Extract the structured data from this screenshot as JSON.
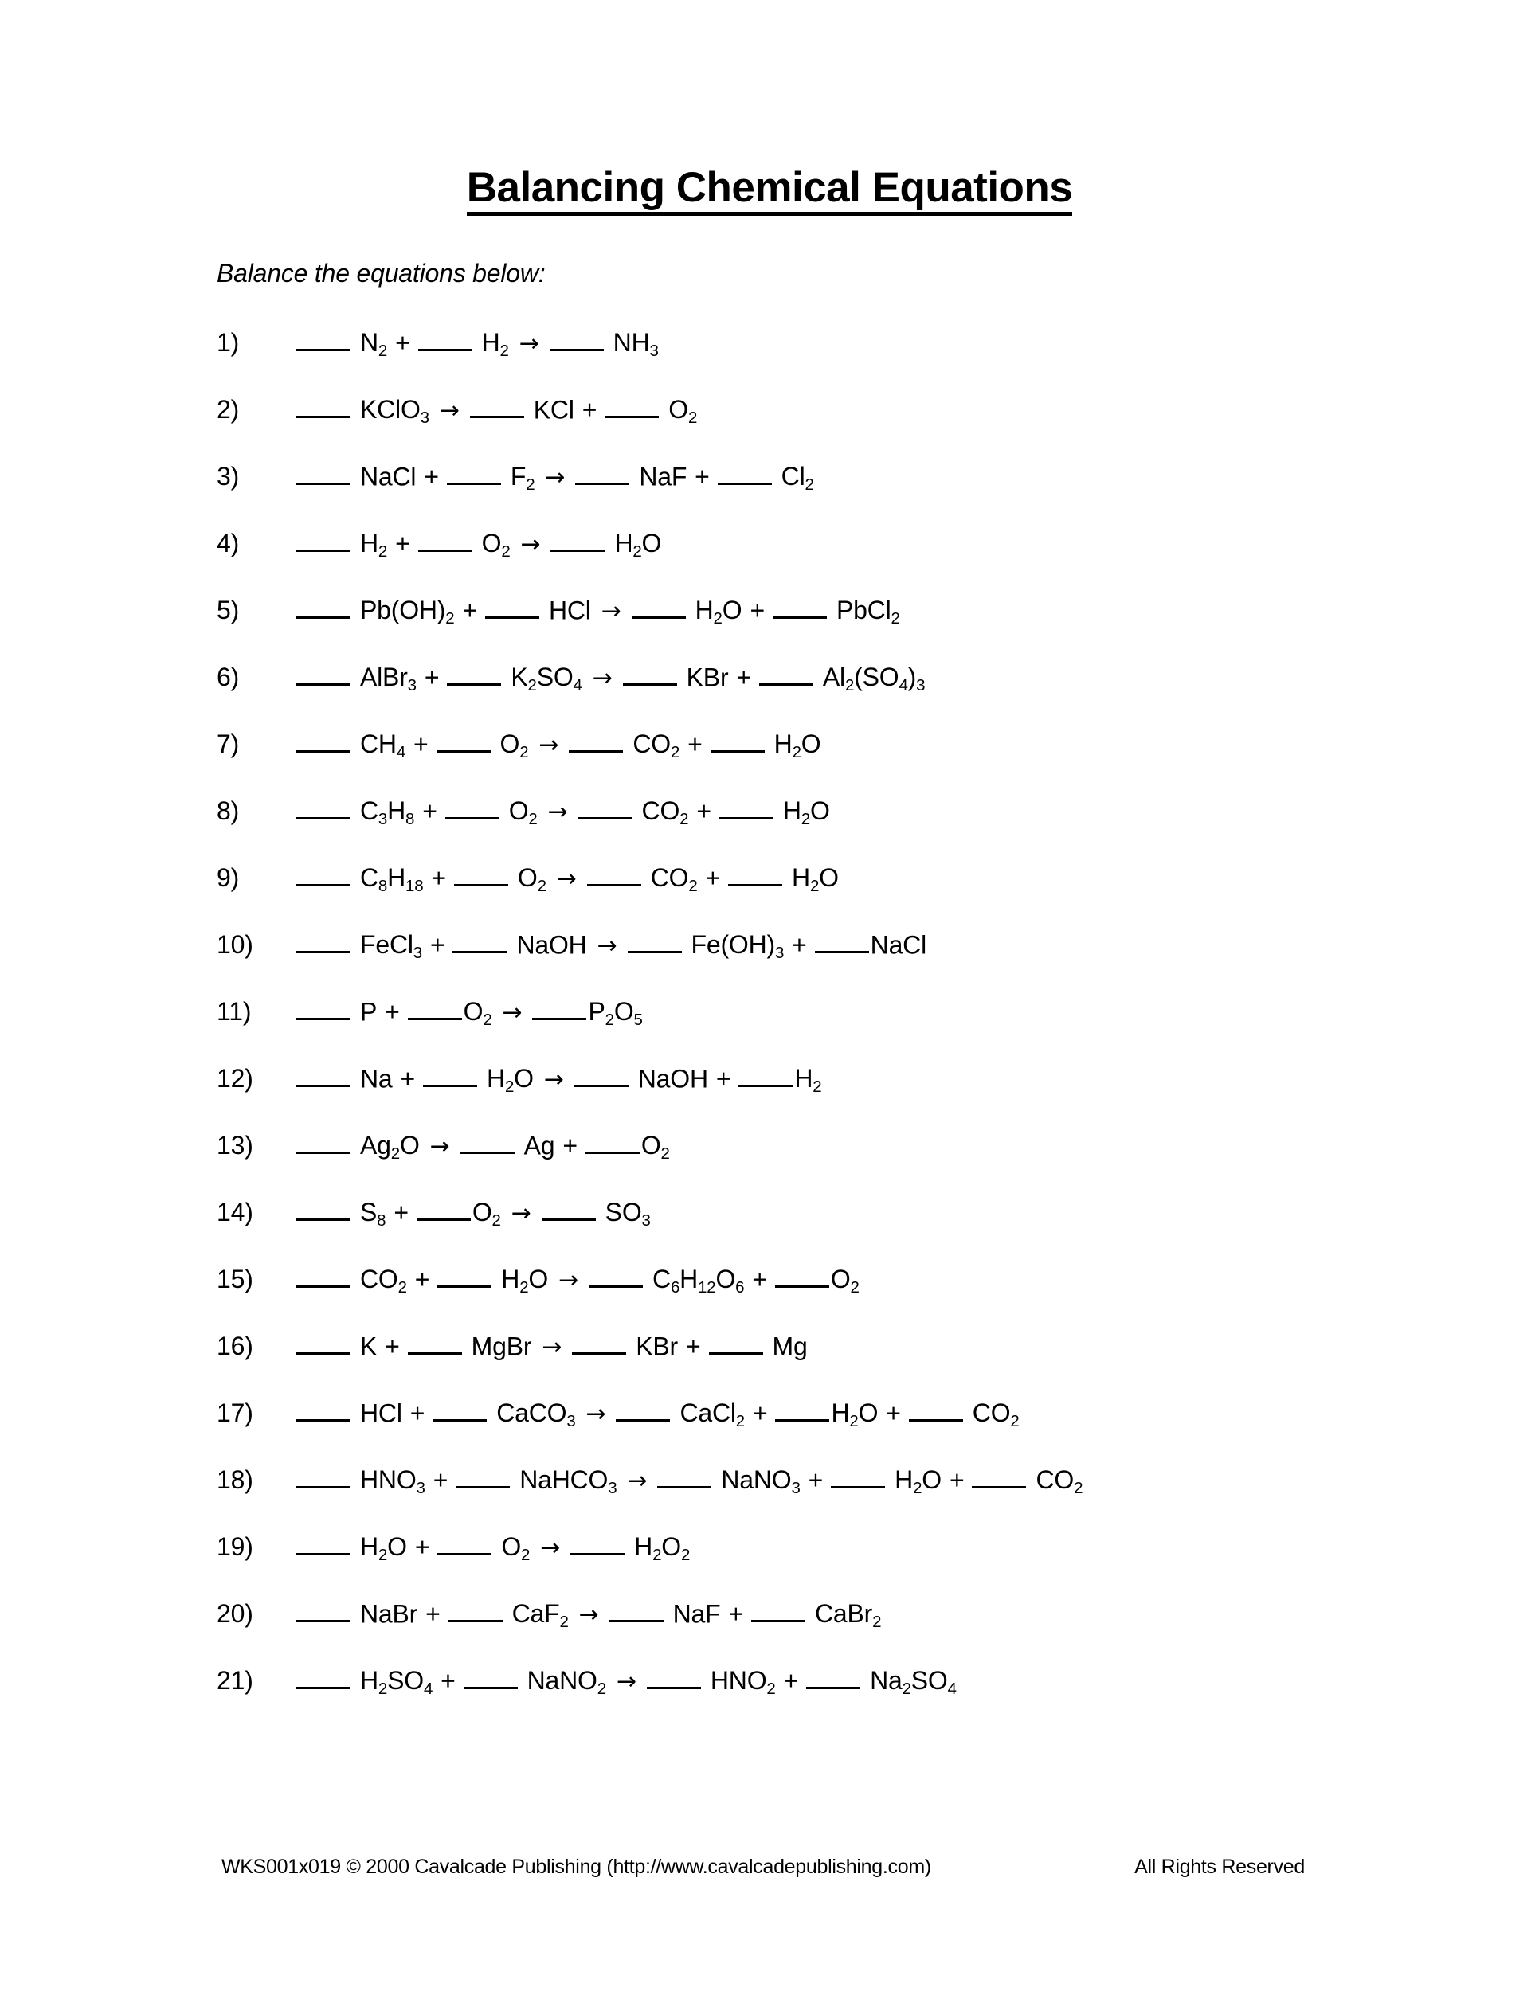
{
  "document": {
    "title": "Balancing Chemical Equations",
    "instruction": "Balance the equations below:",
    "arrow_glyph": "→"
  },
  "equations": [
    {
      "number": "1)",
      "text": "____ N2 + ____ H2 → ____ NH3"
    },
    {
      "number": "2)",
      "text": "____ KClO3 → ____ KCl + ____ O2"
    },
    {
      "number": "3)",
      "text": "____ NaCl + ____ F2 → ____ NaF + ____ Cl2"
    },
    {
      "number": "4)",
      "text": "____ H2 + ____ O2 → ____ H2O"
    },
    {
      "number": "5)",
      "text": "____ Pb(OH)2 + ____ HCl → ____ H2O + ____ PbCl2"
    },
    {
      "number": "6)",
      "text": "____ AlBr3 + ____ K2SO4 → ____ KBr + ____ Al2(SO4)3"
    },
    {
      "number": "7)",
      "text": "____ CH4 + ____ O2 → ____ CO2 + ____ H2O"
    },
    {
      "number": "8)",
      "text": "____ C3H8 + ____ O2 → ____ CO2 + ____ H2O"
    },
    {
      "number": "9)",
      "text": "____ C8H18 + ____ O2 → ____ CO2 + ____ H2O"
    },
    {
      "number": "10)",
      "text": "____ FeCl3 + ____ NaOH → ____ Fe(OH)3 + ____NaCl"
    },
    {
      "number": "11)",
      "text": "____ P + ____O2 → ____P2O5"
    },
    {
      "number": "12)",
      "text": "____ Na + ____ H2O → ____ NaOH + ____H2"
    },
    {
      "number": "13)",
      "text": "____ Ag2O → ____ Ag + ____O2"
    },
    {
      "number": "14)",
      "text": "____ S8 + ____O2 → ____ SO3"
    },
    {
      "number": "15)",
      "text": "____ CO2 + ____ H2O → ____ C6H12O6 + ____O2"
    },
    {
      "number": "16)",
      "text": "____ K + ____ MgBr → ____ KBr + ____ Mg"
    },
    {
      "number": "17)",
      "text": "____ HCl + ____ CaCO3 → ____ CaCl2 + ____H2O + ____ CO2"
    },
    {
      "number": "18)",
      "text": "____ HNO3 + ____ NaHCO3 → ____ NaNO3 + ____ H2O + ____ CO2"
    },
    {
      "number": "19)",
      "text": "____ H2O + ____ O2 → ____ H2O2"
    },
    {
      "number": "20)",
      "text": "____ NaBr + ____ CaF2 → ____ NaF + ____ CaBr2"
    },
    {
      "number": "21)",
      "text": "____ H2SO4 + ____ NaNO2 → ____ HNO2 + ____ Na2SO4"
    }
  ],
  "footer": {
    "left": "WKS001x019  © 2000 Cavalcade Publishing (http://www.cavalcadepublishing.com)",
    "right": "All Rights Reserved"
  }
}
